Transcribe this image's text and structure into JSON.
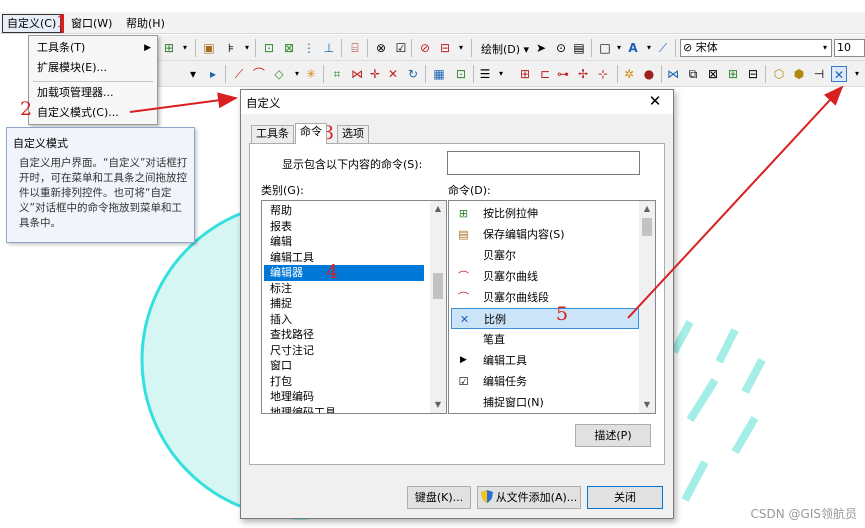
{
  "menubar": {
    "items": [
      "自定义(C)",
      "窗口(W)",
      "帮助(H)"
    ]
  },
  "toolbar": {
    "draw_label": "绘制(D)",
    "font_name": "宋体",
    "font_size": "10"
  },
  "dropdown": {
    "items": [
      "工具条(T)",
      "扩展模块(E)...",
      "加载项管理器...",
      "自定义模式(C)..."
    ]
  },
  "tooltip": {
    "title": "自定义模式",
    "body": "自定义用户界面。“自定义”对话框打开时，可在菜单和工具条之间拖放控件以重新排列控件。也可将“自定义”对话框中的命令拖放到菜单和工具条中。"
  },
  "dialog": {
    "title": "自定义",
    "close_glyph": "✕",
    "tabs": [
      "工具条",
      "命令",
      "选项"
    ],
    "filter_label": "显示包含以下内容的命令(S):",
    "filter_value": "",
    "categories_label": "类别(G):",
    "commands_label": "命令(D):",
    "categories": [
      "帮助",
      "报表",
      "编辑",
      "编辑工具",
      "编辑器",
      "标注",
      "捕捉",
      "插入",
      "查找路径",
      "尺寸注记",
      "窗口",
      "打包",
      "地理编码",
      "地理编码工具"
    ],
    "selected_category": "编辑器",
    "commands": [
      {
        "label": "按比例拉伸",
        "icon": "scale-stretch-icon"
      },
      {
        "label": "保存编辑内容(S)",
        "icon": "save-edits-icon"
      },
      {
        "label": "贝塞尔",
        "icon": ""
      },
      {
        "label": "贝塞尔曲线",
        "icon": "bezier-curve-icon"
      },
      {
        "label": "贝塞尔曲线段",
        "icon": "bezier-segment-icon"
      },
      {
        "label": "比例",
        "icon": "scale-icon"
      },
      {
        "label": "笔直",
        "icon": ""
      },
      {
        "label": "编辑工具",
        "icon": "edit-tool-arrow-icon"
      },
      {
        "label": "编辑任务",
        "icon": "edit-task-icon"
      },
      {
        "label": "捕捉窗口(N)",
        "icon": ""
      }
    ],
    "selected_command": "比例",
    "describe_button": "描述(P)",
    "keyboard_button": "键盘(K)...",
    "add_from_file_button": "从文件添加(A)...",
    "close_button": "关闭"
  },
  "annotations": {
    "numbers": [
      "1",
      "2",
      "3",
      "4",
      "5"
    ],
    "color": "#d92020"
  },
  "watermark": "CSDN @GIS领航员"
}
